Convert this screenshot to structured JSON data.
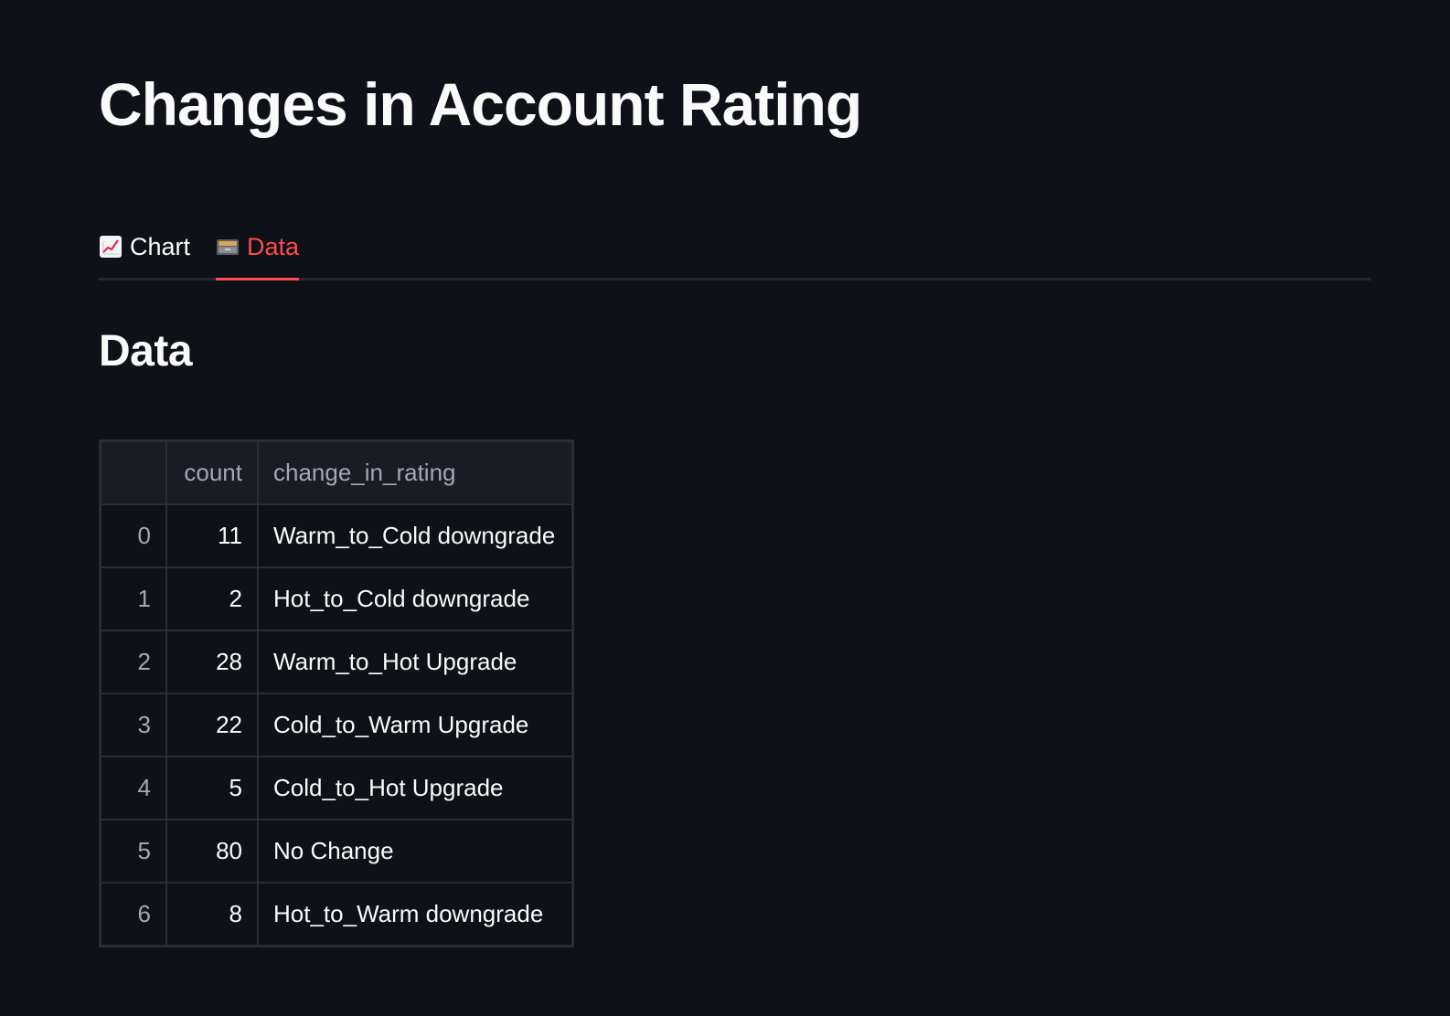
{
  "page": {
    "title": "Changes in Account Rating"
  },
  "tabs": [
    {
      "label": "Chart",
      "icon": "chart-increasing-icon",
      "active": false
    },
    {
      "label": "Data",
      "icon": "card-file-box-icon",
      "active": true
    }
  ],
  "section": {
    "title": "Data"
  },
  "table": {
    "columns": [
      "",
      "count",
      "change_in_rating"
    ],
    "rows": [
      {
        "index": "0",
        "count": "11",
        "change_in_rating": "Warm_to_Cold downgrade"
      },
      {
        "index": "1",
        "count": "2",
        "change_in_rating": "Hot_to_Cold downgrade"
      },
      {
        "index": "2",
        "count": "28",
        "change_in_rating": "Warm_to_Hot Upgrade"
      },
      {
        "index": "3",
        "count": "22",
        "change_in_rating": "Cold_to_Warm Upgrade"
      },
      {
        "index": "4",
        "count": "5",
        "change_in_rating": "Cold_to_Hot Upgrade"
      },
      {
        "index": "5",
        "count": "80",
        "change_in_rating": "No Change"
      },
      {
        "index": "6",
        "count": "8",
        "change_in_rating": "Hot_to_Warm downgrade"
      }
    ]
  },
  "colors": {
    "background": "#0e1117",
    "text": "#fafafa",
    "accent": "#ff4b4b",
    "muted": "#a3a8b8",
    "border": "#2a2c36"
  }
}
